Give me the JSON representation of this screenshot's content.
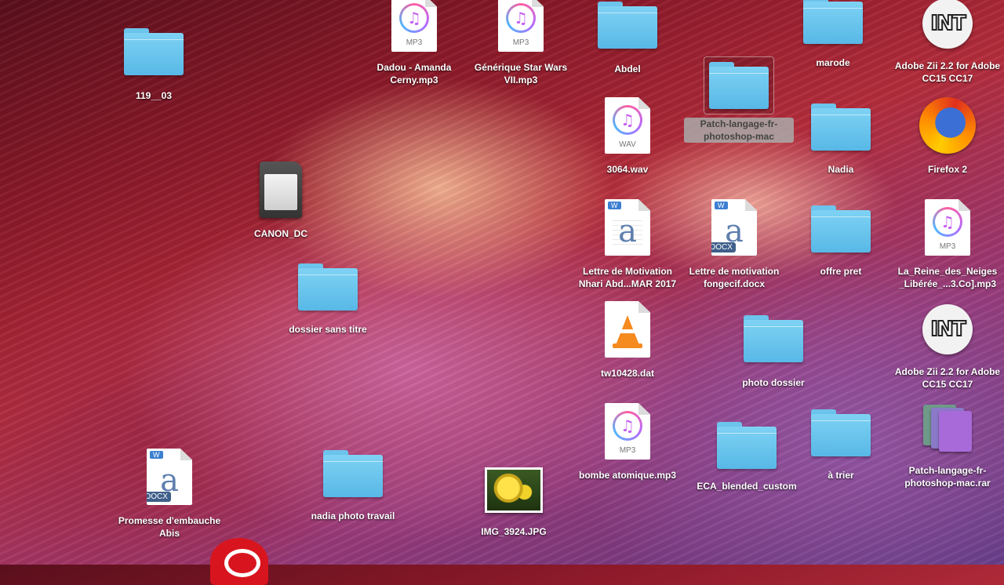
{
  "desktop": {
    "icons": [
      {
        "label": "119__03",
        "kind": "folder"
      },
      {
        "label": "Dadou - Amanda Cerny.mp3",
        "kind": "mp3",
        "type": "MP3"
      },
      {
        "label": "Générique Star Wars VII.mp3",
        "kind": "mp3",
        "type": "MP3"
      },
      {
        "label": "Abdel",
        "kind": "folder"
      },
      {
        "label": "marode",
        "kind": "folder"
      },
      {
        "label": "Adobe Zii 2.2  for Adobe CC15 CC17",
        "kind": "app",
        "badge": "INT"
      },
      {
        "label": "Patch-langage-fr-photoshop-mac",
        "kind": "folder",
        "selected": true
      },
      {
        "label": "3064.wav",
        "kind": "wav",
        "type": "WAV"
      },
      {
        "label": "Nadia",
        "kind": "folder"
      },
      {
        "label": "Firefox 2",
        "kind": "app"
      },
      {
        "label": "CANON_DC",
        "kind": "sdcard"
      },
      {
        "label": "Lettre de Motivation Nhari Abd...MAR 2017",
        "kind": "docx"
      },
      {
        "label": "Lettre de motivation fongecif.docx",
        "kind": "docx",
        "type": "DOCX"
      },
      {
        "label": "offre pret",
        "kind": "folder"
      },
      {
        "label": "La_Reine_des_Neiges _Libérée_...3.Co].mp3",
        "kind": "mp3",
        "type": "MP3"
      },
      {
        "label": "dossier sans titre",
        "kind": "folder"
      },
      {
        "label": "tw10428.dat",
        "kind": "vlc"
      },
      {
        "label": "photo dossier",
        "kind": "folder"
      },
      {
        "label": "Adobe Zii 2.2  for Adobe CC15 CC17",
        "kind": "app",
        "badge": "INT"
      },
      {
        "label": "bombe atomique.mp3",
        "kind": "mp3",
        "type": "MP3"
      },
      {
        "label": "ECA_blended_custom",
        "kind": "folder"
      },
      {
        "label": "à trier",
        "kind": "folder"
      },
      {
        "label": "Patch-langage-fr-photoshop-mac.rar",
        "kind": "rar"
      },
      {
        "label": "Promesse d'embauche Abis",
        "kind": "docx",
        "type": "DOCX"
      },
      {
        "label": "nadia photo travail",
        "kind": "folder"
      },
      {
        "label": "IMG_3924.JPG",
        "kind": "image"
      }
    ]
  },
  "colors": {
    "folder": "#6cc4ec",
    "firefox": "#ff8a00",
    "vlc": "#f58a1f",
    "creative_cloud": "#d8151e"
  },
  "icon_names": {
    "folder": "folder-icon",
    "mp3": "music-file-icon",
    "wav": "audio-file-icon",
    "docx": "word-document-icon",
    "vlc": "vlc-cone-icon",
    "sdcard": "sd-card-icon",
    "app": "app-icon",
    "rar": "archive-icon",
    "image": "image-thumbnail-icon",
    "creative_cloud": "creative-cloud-icon"
  }
}
